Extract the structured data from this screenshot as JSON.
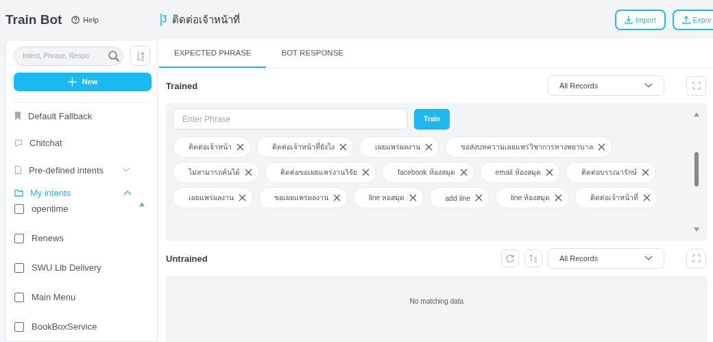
{
  "app": {
    "title": "Train Bot",
    "help": "Help"
  },
  "sidebar": {
    "search": {
      "placeholder": "Intent, Phrase, Respo"
    },
    "new_button": "New",
    "items": [
      {
        "kind": "bookmark",
        "label": "Default Fallback"
      },
      {
        "kind": "chat",
        "label": "Chitchat"
      },
      {
        "kind": "document",
        "label": "Pre-defined intents",
        "expanded": false
      },
      {
        "kind": "folder",
        "label": "My intents",
        "expanded": true,
        "children": [
          {
            "label": "opentime",
            "checked": false
          },
          {
            "label": "Renews",
            "checked": false
          },
          {
            "label": "SWU Llb Delivery",
            "checked": false
          },
          {
            "label": "Main Menu",
            "checked": false
          },
          {
            "label": "BookBoxService",
            "checked": false
          }
        ]
      }
    ]
  },
  "header": {
    "intent_title": "ติดต่อเจ้าหน้าที่",
    "buttons": [
      {
        "kind": "import",
        "label": "Import"
      },
      {
        "kind": "export",
        "label": "Expor"
      }
    ]
  },
  "tabs": [
    {
      "label": "EXPECTED PHRASE",
      "selected": true
    },
    {
      "label": "BOT RESPONSE",
      "selected": false
    }
  ],
  "trained": {
    "title": "Trained",
    "filter": "All Records",
    "input": {
      "placeholder": "Enter Phrase"
    },
    "train_button": "Train",
    "phrases": [
      "ติดต่อเจ้าหน้า",
      "ติดต่อเจ้าหน้าที่ยังไง",
      "เผยแพร่ผลงาน",
      "ขอส่งบทความเผยแพร่วิชาการทางพยาบาล",
      "ไม่สามารถค้นได้",
      "ติดต่อขอเผยแพร่งานวิจัย",
      "facebook ห้องสมุด",
      "email ห้องสมุด",
      "ติดต่อบรรณารักษ์",
      "เผยแพร่ผลงาน",
      "ขอเผยแพร่ผลงาน",
      "line หอสมุด",
      "add line",
      "line ห้องสมุด",
      "ติดต่อเจ้าหน้าที่"
    ]
  },
  "untrained": {
    "title": "Untrained",
    "filter": "All Records",
    "empty": "No matching data"
  }
}
